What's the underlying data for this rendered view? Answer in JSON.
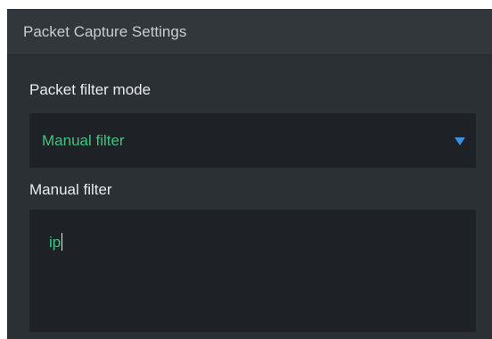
{
  "panel": {
    "title": "Packet Capture Settings"
  },
  "filter_mode": {
    "label": "Packet filter mode",
    "selected": "Manual filter",
    "arrow_icon": "triangle-down-icon",
    "arrow_color": "#3d8fe0"
  },
  "manual_filter": {
    "label": "Manual filter",
    "value": "ip"
  },
  "colors": {
    "accent_text": "#3fc380",
    "panel_bg": "#2b3035",
    "field_bg": "#1e2226"
  }
}
